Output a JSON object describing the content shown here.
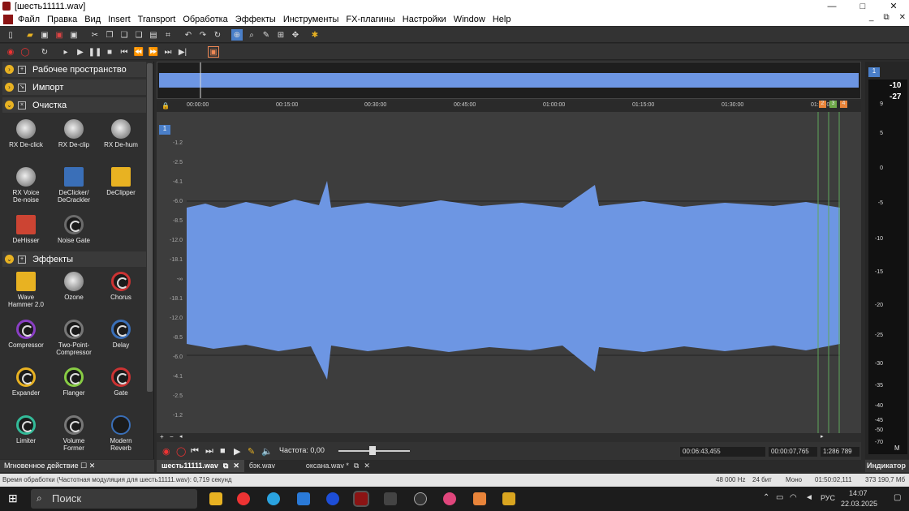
{
  "window": {
    "title": "[шесть11111.wav]",
    "controls": [
      "—",
      "□",
      "✕"
    ]
  },
  "menu": [
    "Файл",
    "Правка",
    "Вид",
    "Insert",
    "Transport",
    "Обработка",
    "Эффекты",
    "Инструменты",
    "FX-плагины",
    "Настройки",
    "Window",
    "Help"
  ],
  "mdi_controls": [
    "_",
    "⧉",
    "✕"
  ],
  "sidebar": {
    "groups": [
      {
        "label": "Рабочее пространство"
      },
      {
        "label": "Импорт"
      },
      {
        "label": "Очистка"
      },
      {
        "label": "Эффекты"
      }
    ],
    "cleanup_plugins": [
      "RX De-click",
      "RX De-clip",
      "RX De-hum",
      "RX Voice De-noise",
      "DeClicker/ DeCrackler",
      "DeClipper",
      "DeHisser",
      "Noise Gate"
    ],
    "effect_plugins": [
      "Wave Hammer 2.0",
      "Ozone",
      "Chorus",
      "Compressor",
      "Two-Point-Compressor",
      "Delay",
      "Expander",
      "Flanger",
      "Gate",
      "Limiter",
      "Volume Former",
      "Modern Reverb"
    ],
    "footer": "Мгновенное действие"
  },
  "timeline": {
    "ticks": [
      "00:00:00",
      "00:15:00",
      "00:30:00",
      "00:45:00",
      "01:00:00",
      "01:15:00",
      "01:30:00",
      "01:45:00"
    ],
    "track_number": "1",
    "markers": [
      "2",
      "3",
      "4"
    ],
    "db_labels": [
      "-1.2",
      "-2.5",
      "-4.1",
      "-6.0",
      "-8.5",
      "-12.0",
      "-18.1",
      "-∞",
      "-18.1",
      "-12.0",
      "-8.5",
      "-6.0",
      "-4.1",
      "-2.5",
      "-1.2"
    ]
  },
  "transport": {
    "rate_label": "Частота: 0,00",
    "position": "00:06:43,455",
    "selection": "00:00:07,765",
    "zoom": "1:286 789"
  },
  "doc_tabs": [
    {
      "label": "шесть11111.wav",
      "active": true
    },
    {
      "label": "бэк.wav",
      "active": false
    },
    {
      "label": "оксана.wav *",
      "active": false
    }
  ],
  "meter": {
    "channel": "1",
    "peak_top": "-10",
    "peak_bottom": "-27",
    "scale": [
      "9",
      "5",
      "0",
      "-5",
      "-10",
      "-15",
      "-20",
      "-25",
      "-30",
      "-35",
      "-40",
      "-45",
      "-50",
      "-70"
    ],
    "unit": "M",
    "title": "Индикатор"
  },
  "status": {
    "message": "Время обработки (Частотная модуляция для шесть11111.wav): 0,719 секунд",
    "rate": "48 000 Hz",
    "bits": "24 бит",
    "channels": "Моно",
    "length": "01:50:02,111",
    "disk": "373 190,7 Мб"
  },
  "taskbar": {
    "search": "Поиск",
    "lang": "РУС",
    "time": "14:07",
    "date": "22.03.2025"
  },
  "colors": {
    "wave": "#6d96e3",
    "bg": "#3d3d3d",
    "accent": "#e8b222"
  }
}
